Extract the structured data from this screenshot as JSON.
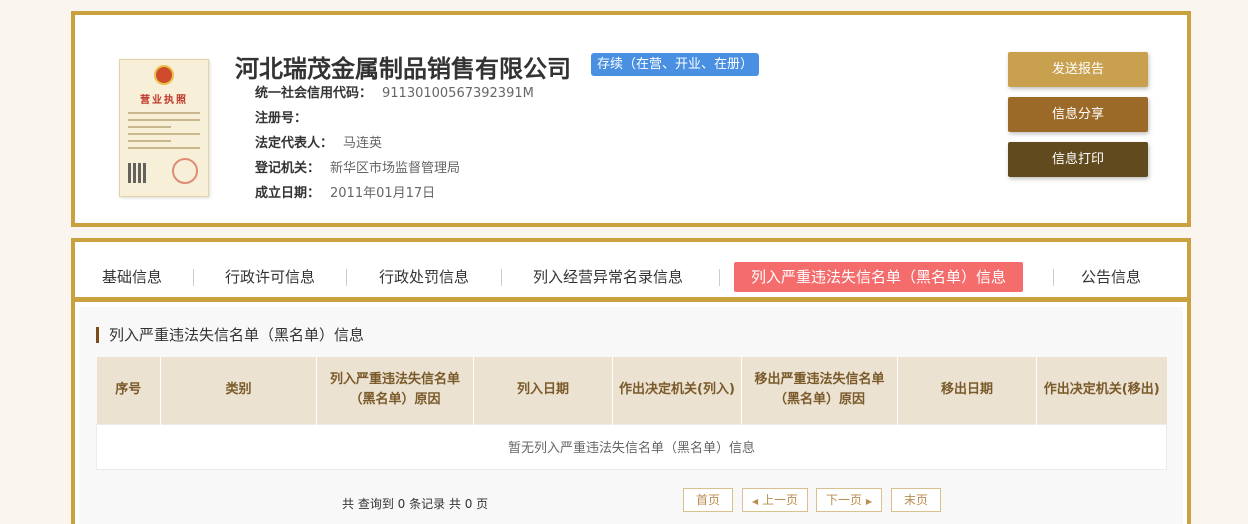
{
  "company": {
    "name": "河北瑞茂金属制品销售有限公司",
    "status": "存续（在营、开业、在册）",
    "license_title": "营业执照",
    "fields": [
      {
        "label": "统一社会信用代码：",
        "value": "91130100567392391M"
      },
      {
        "label": "注册号：",
        "value": ""
      },
      {
        "label": "法定代表人：",
        "value": "马连英"
      },
      {
        "label": "登记机关：",
        "value": "新华区市场监督管理局"
      },
      {
        "label": "成立日期：",
        "value": "2011年01月17日"
      }
    ]
  },
  "actions": {
    "send_report": "发送报告",
    "share": "信息分享",
    "print": "信息打印"
  },
  "tabs": [
    {
      "label": "基础信息",
      "active": false
    },
    {
      "label": "行政许可信息",
      "active": false
    },
    {
      "label": "行政处罚信息",
      "active": false
    },
    {
      "label": "列入经营异常名录信息",
      "active": false
    },
    {
      "label": "列入严重违法失信名单（黑名单）信息",
      "active": true
    },
    {
      "label": "公告信息",
      "active": false
    }
  ],
  "section": {
    "title": "列入严重违法失信名单（黑名单）信息",
    "columns": [
      "序号",
      "类别",
      "列入严重违法失信名单（黑名单）原因",
      "列入日期",
      "作出决定机关(列入)",
      "移出严重违法失信名单（黑名单）原因",
      "移出日期",
      "作出决定机关(移出)"
    ],
    "empty_text": "暂无列入严重违法失信名单（黑名单）信息"
  },
  "pagination": {
    "summary": "共 查询到 0 条记录 共 0 页",
    "first": "首页",
    "prev": "上一页",
    "next": "下一页",
    "last": "末页"
  },
  "colors": {
    "frame_gold": "#c9a23f",
    "status_blue": "#4a90e2",
    "active_tab": "#f56c6c",
    "btn_send": "#c9a04e",
    "btn_share": "#9b6a28",
    "btn_print": "#614a1e"
  }
}
